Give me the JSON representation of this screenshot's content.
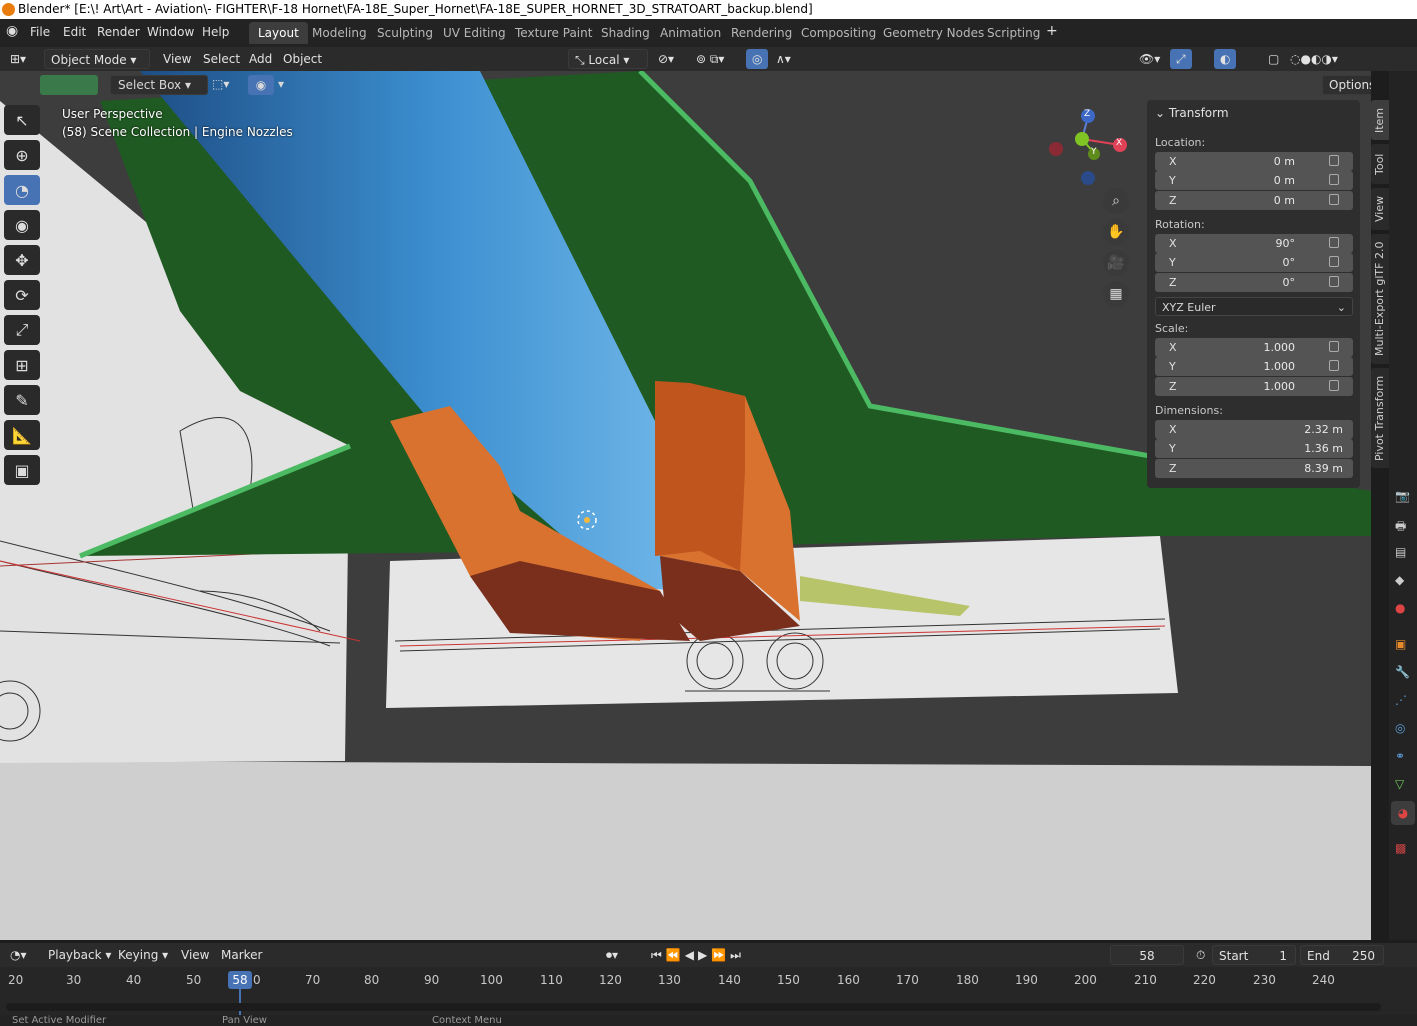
{
  "window_title": "Blender* [E:\\! Art\\Art - Aviation\\- FIGHTER\\F-18 Hornet\\FA-18E_Super_Hornet\\FA-18E_SUPER_HORNET_3D_STRATOART_backup.blend]",
  "top_menu": [
    "File",
    "Edit",
    "Render",
    "Window",
    "Help"
  ],
  "workspaces": [
    "Layout",
    "Modeling",
    "Sculpting",
    "UV Editing",
    "Texture Paint",
    "Shading",
    "Animation",
    "Rendering",
    "Compositing",
    "Geometry Nodes",
    "Scripting"
  ],
  "active_workspace": "Layout",
  "header": {
    "mode": "Object Mode",
    "menus": [
      "View",
      "Select",
      "Add",
      "Object"
    ],
    "transform_orientation": "Local",
    "select_tool": "Select Box",
    "options": "Options"
  },
  "viewport": {
    "perspective": "User Perspective",
    "collection": "(58) Scene Collection | Engine Nozzles",
    "gizmo_axes": [
      "X",
      "Y",
      "Z"
    ]
  },
  "npanel": {
    "section": "Transform",
    "location_label": "Location:",
    "location": [
      {
        "axis": "X",
        "value": "0 m"
      },
      {
        "axis": "Y",
        "value": "0 m"
      },
      {
        "axis": "Z",
        "value": "0 m"
      }
    ],
    "rotation_label": "Rotation:",
    "rotation": [
      {
        "axis": "X",
        "value": "90°"
      },
      {
        "axis": "Y",
        "value": "0°"
      },
      {
        "axis": "Z",
        "value": "0°"
      }
    ],
    "rotation_mode": "XYZ Euler",
    "scale_label": "Scale:",
    "scale": [
      {
        "axis": "X",
        "value": "1.000"
      },
      {
        "axis": "Y",
        "value": "1.000"
      },
      {
        "axis": "Z",
        "value": "1.000"
      }
    ],
    "dimensions_label": "Dimensions:",
    "dimensions": [
      {
        "axis": "X",
        "value": "2.32 m"
      },
      {
        "axis": "Y",
        "value": "1.36 m"
      },
      {
        "axis": "Z",
        "value": "8.39 m"
      }
    ],
    "tabs": [
      "Item",
      "Tool",
      "View",
      "Multi-Export glTF 2.0",
      "Pivot Transform"
    ]
  },
  "timeline": {
    "menus": [
      "Playback",
      "Keying",
      "View",
      "Marker"
    ],
    "current_frame": "58",
    "start_label": "Start",
    "start": "1",
    "end_label": "End",
    "end": "250",
    "ticks": [
      "20",
      "30",
      "40",
      "50",
      "0",
      "70",
      "80",
      "90",
      "100",
      "110",
      "120",
      "130",
      "140",
      "150",
      "160",
      "170",
      "180",
      "190",
      "200",
      "210",
      "220",
      "230",
      "240"
    ]
  },
  "statusbar": [
    "Set Active Modifier",
    "Pan View",
    "Context Menu"
  ],
  "colors": {
    "accent": "#4772b3",
    "fuselage_blue": "#3c8fd0",
    "wing_green": "#1f5a22",
    "wing_edge": "#4cba62",
    "nozzle_orange": "#d9722f"
  }
}
